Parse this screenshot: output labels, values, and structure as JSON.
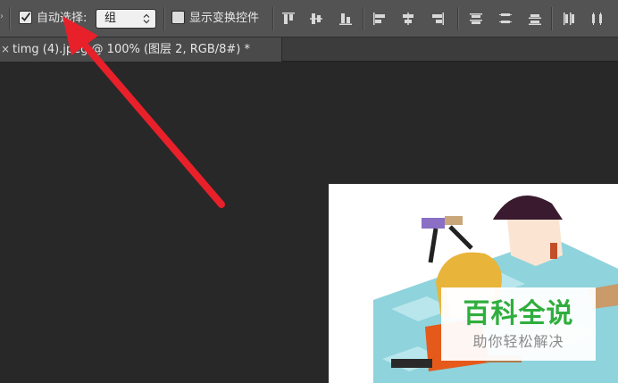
{
  "options_bar": {
    "auto_select_label": "自动选择:",
    "auto_select_checked": true,
    "auto_select_target": "组",
    "show_transform_label": "显示变换控件",
    "show_transform_checked": false,
    "align_icons": [
      "align-top-edges-icon",
      "align-vertical-centers-icon",
      "align-bottom-edges-icon",
      "align-left-edges-icon",
      "align-horizontal-centers-icon",
      "align-right-edges-icon"
    ],
    "distribute_icons": [
      "distribute-top-icon",
      "distribute-vertical-centers-icon",
      "distribute-bottom-icon",
      "distribute-left-icon",
      "distribute-horizontal-centers-icon"
    ]
  },
  "document_tab": {
    "close_glyph": "×",
    "title": "timg (4).jpeg @ 100% (图层 2, RGB/8#) *"
  },
  "watermark": {
    "title": "百科全说",
    "subtitle": "助你轻松解决",
    "color": "#2fae3d"
  },
  "annotation": {
    "arrow_color": "#e8202a"
  },
  "colors": {
    "options_bar_bg": "#535353",
    "workspace_bg": "#282828",
    "tab_bg": "#4a4a4a"
  }
}
